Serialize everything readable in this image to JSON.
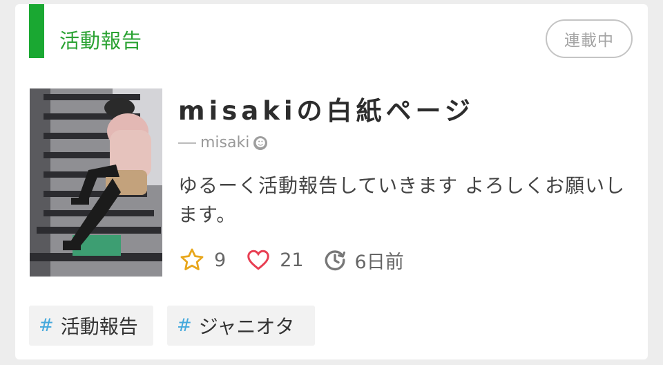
{
  "header": {
    "category": "活動報告",
    "status_badge": "連載中",
    "accent_color": "#1aa832"
  },
  "item": {
    "title": "misakiの白紙ページ",
    "author": "misaki",
    "description": "ゆるーく活動報告していきます よろしくお願いします。",
    "thumbnail_icon": "cover-image",
    "stats": {
      "favorites": "9",
      "likes": "21",
      "updated": "6日前"
    }
  },
  "tags": [
    "活動報告",
    "ジャニオタ"
  ],
  "icons": {
    "favorite": "star-icon",
    "like": "heart-icon",
    "updated": "clock-icon",
    "author_badge": "smile-icon"
  },
  "colors": {
    "star": "#e8a71d",
    "heart": "#e83e52",
    "hash": "#44a8dc"
  }
}
